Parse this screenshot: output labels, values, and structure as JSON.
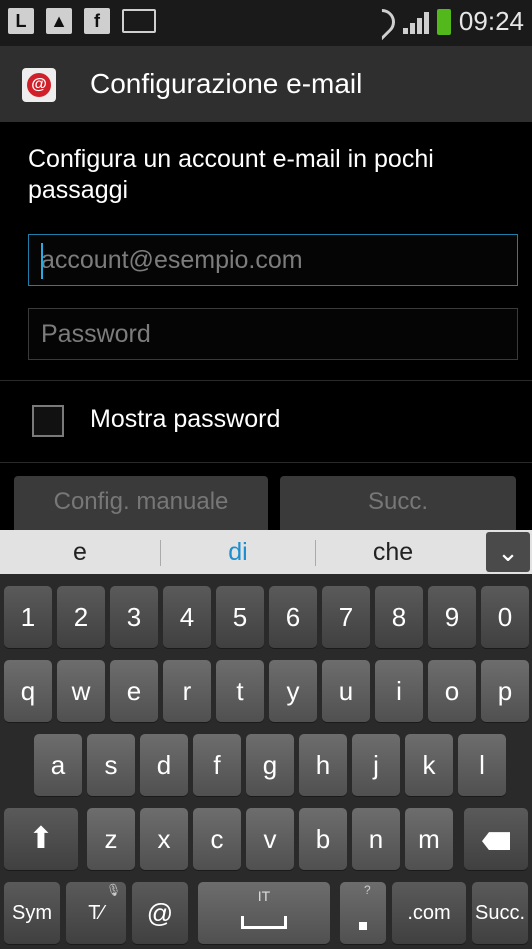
{
  "statusbar": {
    "time": "09:24"
  },
  "titlebar": {
    "title": "Configurazione e-mail"
  },
  "main": {
    "intro": "Configura un account e-mail in pochi passaggi",
    "email_placeholder": "account@esempio.com",
    "password_placeholder": "Password",
    "show_password_label": "Mostra password",
    "manual_setup_label": "Config. manuale",
    "next_label": "Succ."
  },
  "keyboard": {
    "suggestions": [
      "e",
      "di",
      "che"
    ],
    "row_numbers": [
      "1",
      "2",
      "3",
      "4",
      "5",
      "6",
      "7",
      "8",
      "9",
      "0"
    ],
    "row_q": [
      "q",
      "w",
      "e",
      "r",
      "t",
      "y",
      "u",
      "i",
      "o",
      "p"
    ],
    "row_a": [
      "a",
      "s",
      "d",
      "f",
      "g",
      "h",
      "j",
      "k",
      "l"
    ],
    "row_z": [
      "z",
      "x",
      "c",
      "v",
      "b",
      "n",
      "m"
    ],
    "sym_label": "Sym",
    "at_label": "@",
    "space_lang": "IT",
    "dotcom_label": ".com",
    "next_key_label": "Succ."
  }
}
